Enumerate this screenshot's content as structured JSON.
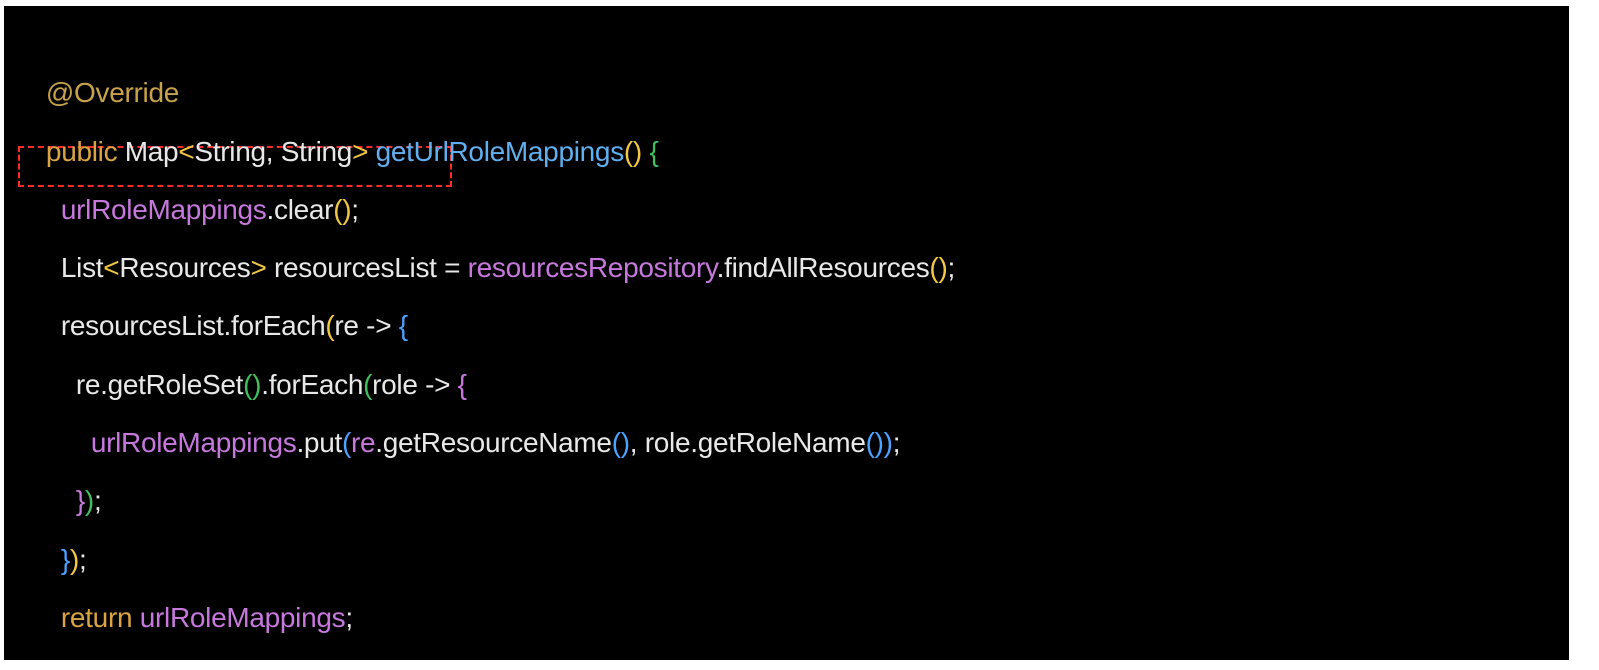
{
  "colors": {
    "background": "#000000",
    "default": "#e8e8e8",
    "annotation": "#c8a24a",
    "keyword": "#d9a441",
    "field": "#c678dd",
    "method": "#61afef",
    "paren_gold": "#f2c744",
    "paren_purple": "#c678dd",
    "paren_blue": "#4aa3ff",
    "brace_green": "#3fbf5f",
    "highlight": "#ff2a2a"
  },
  "code_lines": [
    [
      {
        "text": "@Override",
        "color": "#c8a24a"
      }
    ],
    [
      {
        "text": "public",
        "color": "#d9a441"
      },
      {
        "text": " Map",
        "color": "#e8e8e8"
      },
      {
        "text": "<",
        "color": "#f2c744"
      },
      {
        "text": "String, String",
        "color": "#e8e8e8"
      },
      {
        "text": ">",
        "color": "#f2c744"
      },
      {
        "text": " ",
        "color": "#e8e8e8"
      },
      {
        "text": "getUrlRoleMappings",
        "color": "#61afef"
      },
      {
        "text": "()",
        "color": "#f2c744"
      },
      {
        "text": " ",
        "color": "#e8e8e8"
      },
      {
        "text": "{",
        "color": "#3fbf5f"
      }
    ],
    [
      {
        "text": "  ",
        "color": "#e8e8e8"
      },
      {
        "text": "urlRoleMappings",
        "color": "#c678dd"
      },
      {
        "text": ".clear",
        "color": "#e8e8e8"
      },
      {
        "text": "()",
        "color": "#f2c744"
      },
      {
        "text": ";",
        "color": "#e8e8e8"
      }
    ],
    [
      {
        "text": "  List",
        "color": "#e8e8e8"
      },
      {
        "text": "<",
        "color": "#f2c744"
      },
      {
        "text": "Resources",
        "color": "#e8e8e8"
      },
      {
        "text": ">",
        "color": "#f2c744"
      },
      {
        "text": " resourcesList = ",
        "color": "#e8e8e8"
      },
      {
        "text": "resourcesRepository",
        "color": "#c678dd"
      },
      {
        "text": ".findAllResources",
        "color": "#e8e8e8"
      },
      {
        "text": "()",
        "color": "#f2c744"
      },
      {
        "text": ";",
        "color": "#e8e8e8"
      }
    ],
    [
      {
        "text": "  resourcesList.forEach",
        "color": "#e8e8e8"
      },
      {
        "text": "(",
        "color": "#f2c744"
      },
      {
        "text": "re -> ",
        "color": "#e8e8e8"
      },
      {
        "text": "{",
        "color": "#4aa3ff"
      }
    ],
    [
      {
        "text": "    re.getRoleSet",
        "color": "#e8e8e8"
      },
      {
        "text": "()",
        "color": "#3fbf5f"
      },
      {
        "text": ".forEach",
        "color": "#e8e8e8"
      },
      {
        "text": "(",
        "color": "#3fbf5f"
      },
      {
        "text": "role -> ",
        "color": "#e8e8e8"
      },
      {
        "text": "{",
        "color": "#c678dd"
      }
    ],
    [
      {
        "text": "      ",
        "color": "#e8e8e8"
      },
      {
        "text": "urlRoleMappings",
        "color": "#c678dd"
      },
      {
        "text": ".put",
        "color": "#e8e8e8"
      },
      {
        "text": "(",
        "color": "#4aa3ff"
      },
      {
        "text": "re",
        "color": "#c678dd"
      },
      {
        "text": ".getResourceName",
        "color": "#e8e8e8"
      },
      {
        "text": "()",
        "color": "#4aa3ff"
      },
      {
        "text": ", role.getRoleName",
        "color": "#e8e8e8"
      },
      {
        "text": "()",
        "color": "#4aa3ff"
      },
      {
        "text": ")",
        "color": "#4aa3ff"
      },
      {
        "text": ";",
        "color": "#e8e8e8"
      }
    ],
    [
      {
        "text": "    ",
        "color": "#e8e8e8"
      },
      {
        "text": "}",
        "color": "#c678dd"
      },
      {
        "text": ")",
        "color": "#3fbf5f"
      },
      {
        "text": ";",
        "color": "#e8e8e8"
      }
    ],
    [
      {
        "text": "  ",
        "color": "#e8e8e8"
      },
      {
        "text": "}",
        "color": "#4aa3ff"
      },
      {
        "text": ")",
        "color": "#f2c744"
      },
      {
        "text": ";",
        "color": "#e8e8e8"
      }
    ],
    [
      {
        "text": "  ",
        "color": "#e8e8e8"
      },
      {
        "text": "return",
        "color": "#d9a441"
      },
      {
        "text": " ",
        "color": "#e8e8e8"
      },
      {
        "text": "urlRoleMappings",
        "color": "#c678dd"
      },
      {
        "text": ";",
        "color": "#e8e8e8"
      }
    ],
    [
      {
        "text": "}",
        "color": "#3fbf5f"
      }
    ]
  ]
}
